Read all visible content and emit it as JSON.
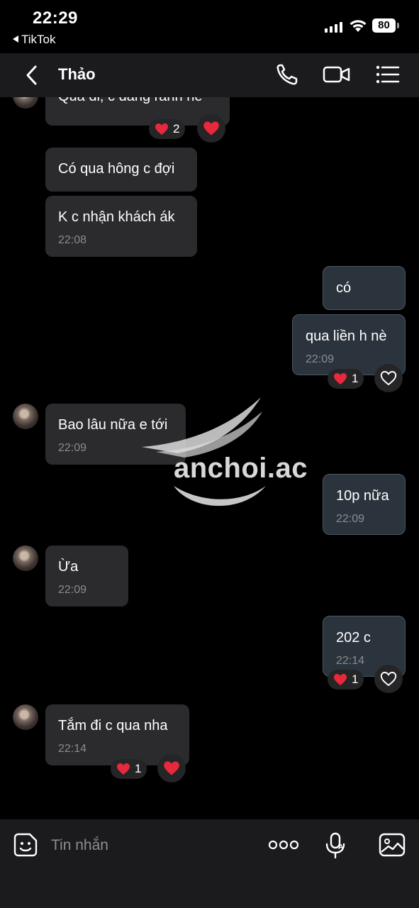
{
  "status_bar": {
    "time": "22:29",
    "back_app": "TikTok",
    "battery": "80"
  },
  "header": {
    "contact_name": "Thảo",
    "icons": [
      "back-chevron-icon",
      "phone-icon",
      "video-icon",
      "menu-list-icon"
    ]
  },
  "messages": [
    {
      "side": "received",
      "text": "Qua đi, c đang rảnh nè",
      "reaction_count": "2"
    },
    {
      "side": "received",
      "text": "Có qua hông c đợi"
    },
    {
      "side": "received",
      "text": "K c nhận khách ák",
      "time": "22:08"
    },
    {
      "side": "sent",
      "text": "có"
    },
    {
      "side": "sent",
      "text": "qua liền h nè",
      "time": "22:09",
      "reaction_count": "1"
    },
    {
      "side": "received",
      "text": "Bao lâu nữa e tới",
      "time": "22:09"
    },
    {
      "side": "sent",
      "text": "10p nữa",
      "time": "22:09"
    },
    {
      "side": "received",
      "text": "Ừa",
      "time": "22:09"
    },
    {
      "side": "sent",
      "text": "202 c",
      "time": "22:14",
      "reaction_count": "1"
    },
    {
      "side": "received",
      "text": "Tắm đi c qua nha",
      "time": "22:14",
      "reaction_count": "1"
    }
  ],
  "watermark": "anchoi.ac",
  "composer": {
    "placeholder": "Tin nhắn",
    "icons": [
      "emoji-sticker-icon",
      "more-dots-icon",
      "voice-mic-icon",
      "image-gallery-icon"
    ]
  },
  "colors": {
    "background": "#000000",
    "received_bubble": "#2b2b2d",
    "sent_bubble": "#2b343d",
    "heart": "#e8283c"
  }
}
